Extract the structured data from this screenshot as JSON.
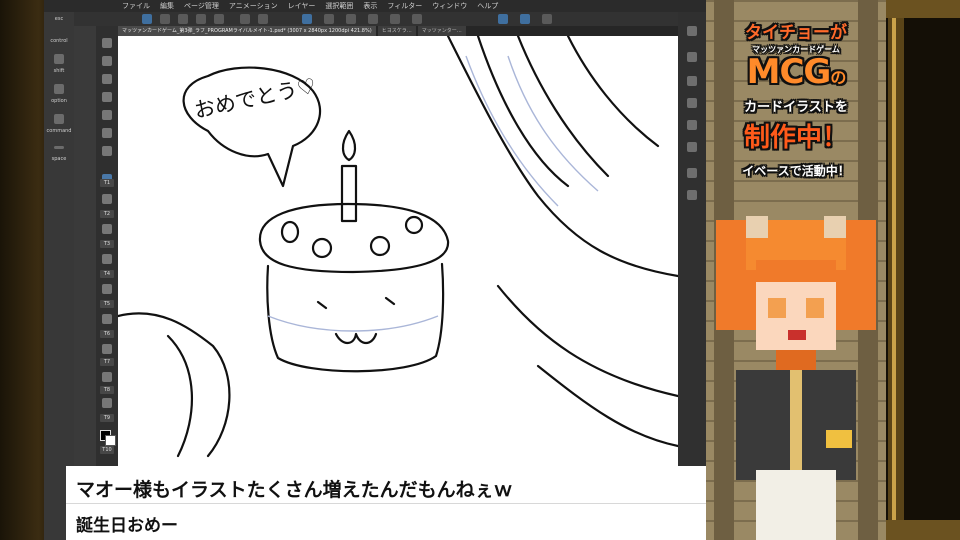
{
  "app": {
    "menu": [
      "ファイル",
      "編集",
      "ページ管理",
      "アニメーション",
      "レイヤー",
      "選択範囲",
      "表示",
      "フィルター",
      "ウィンドウ",
      "ヘルプ"
    ]
  },
  "tabs": [
    {
      "label": "マッツァンカードゲーム_第3弾_ラフ_PROGRAMライバルメイト-1.psd* (3007 x 2840px 1200dpi 421.8%)",
      "active": true
    },
    {
      "label": "ヒヨスケラ…",
      "active": false
    },
    {
      "label": "マッツァンター…",
      "active": false
    }
  ],
  "left_labels": {
    "esc": "esc",
    "control": "control",
    "shift": "shift",
    "option": "option",
    "command": "command",
    "space": "space"
  },
  "tool_labels": [
    "T1",
    "T2",
    "T3",
    "T4",
    "T5",
    "T6",
    "T7",
    "T8",
    "T9",
    "T10"
  ],
  "canvas": {
    "speech_text": "おめでとう♡"
  },
  "caption": {
    "line1": "マオー様もイラストたくさん増えたんだもんねぇｗ",
    "line2": "誕生日おめー"
  },
  "side_banner": {
    "line1": "タイチョーが",
    "line2": "マッツァンカードゲーム",
    "line3": "MCG",
    "line3b": "の",
    "line4": "カードイラストを",
    "line5": "制作中！",
    "line6": "イベースで活動中！"
  },
  "colors": {
    "accent_orange": "#ff7a2a",
    "canvas_bg": "#ffffff",
    "ui_dark": "#3a3a3a"
  }
}
